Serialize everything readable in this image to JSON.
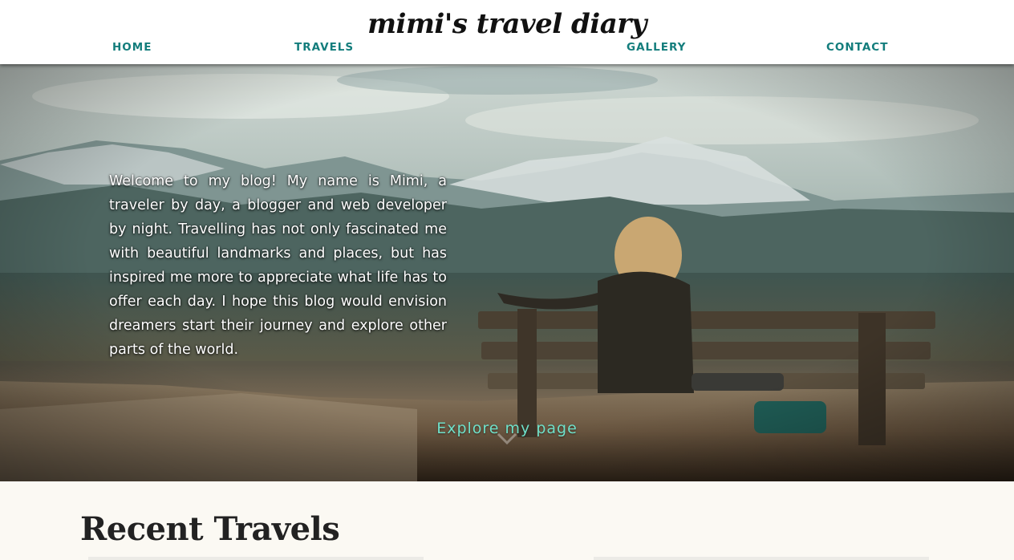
{
  "header": {
    "logo": "mimi's travel diary",
    "nav": {
      "home": "HOME",
      "travels": "TRAVELS",
      "gallery": "GALLERY",
      "contact": "CONTACT"
    }
  },
  "hero": {
    "intro": "Welcome to my blog! My name is Mimi, a traveler by day, a blogger and web developer by night. Travelling has not only fascinated me with beautiful landmarks and places, but has inspired me more to appreciate what life has to offer each day. I hope this blog would envision dreamers start their journey and explore other parts of the world.",
    "cta": "Explore my page",
    "scroll_icon": "chevron-down-icon"
  },
  "recent": {
    "title": "Recent Travels"
  },
  "colors": {
    "nav_accent": "#137d7c",
    "cta_accent": "#6fe0c9",
    "section_bg": "#fbf9f3"
  }
}
